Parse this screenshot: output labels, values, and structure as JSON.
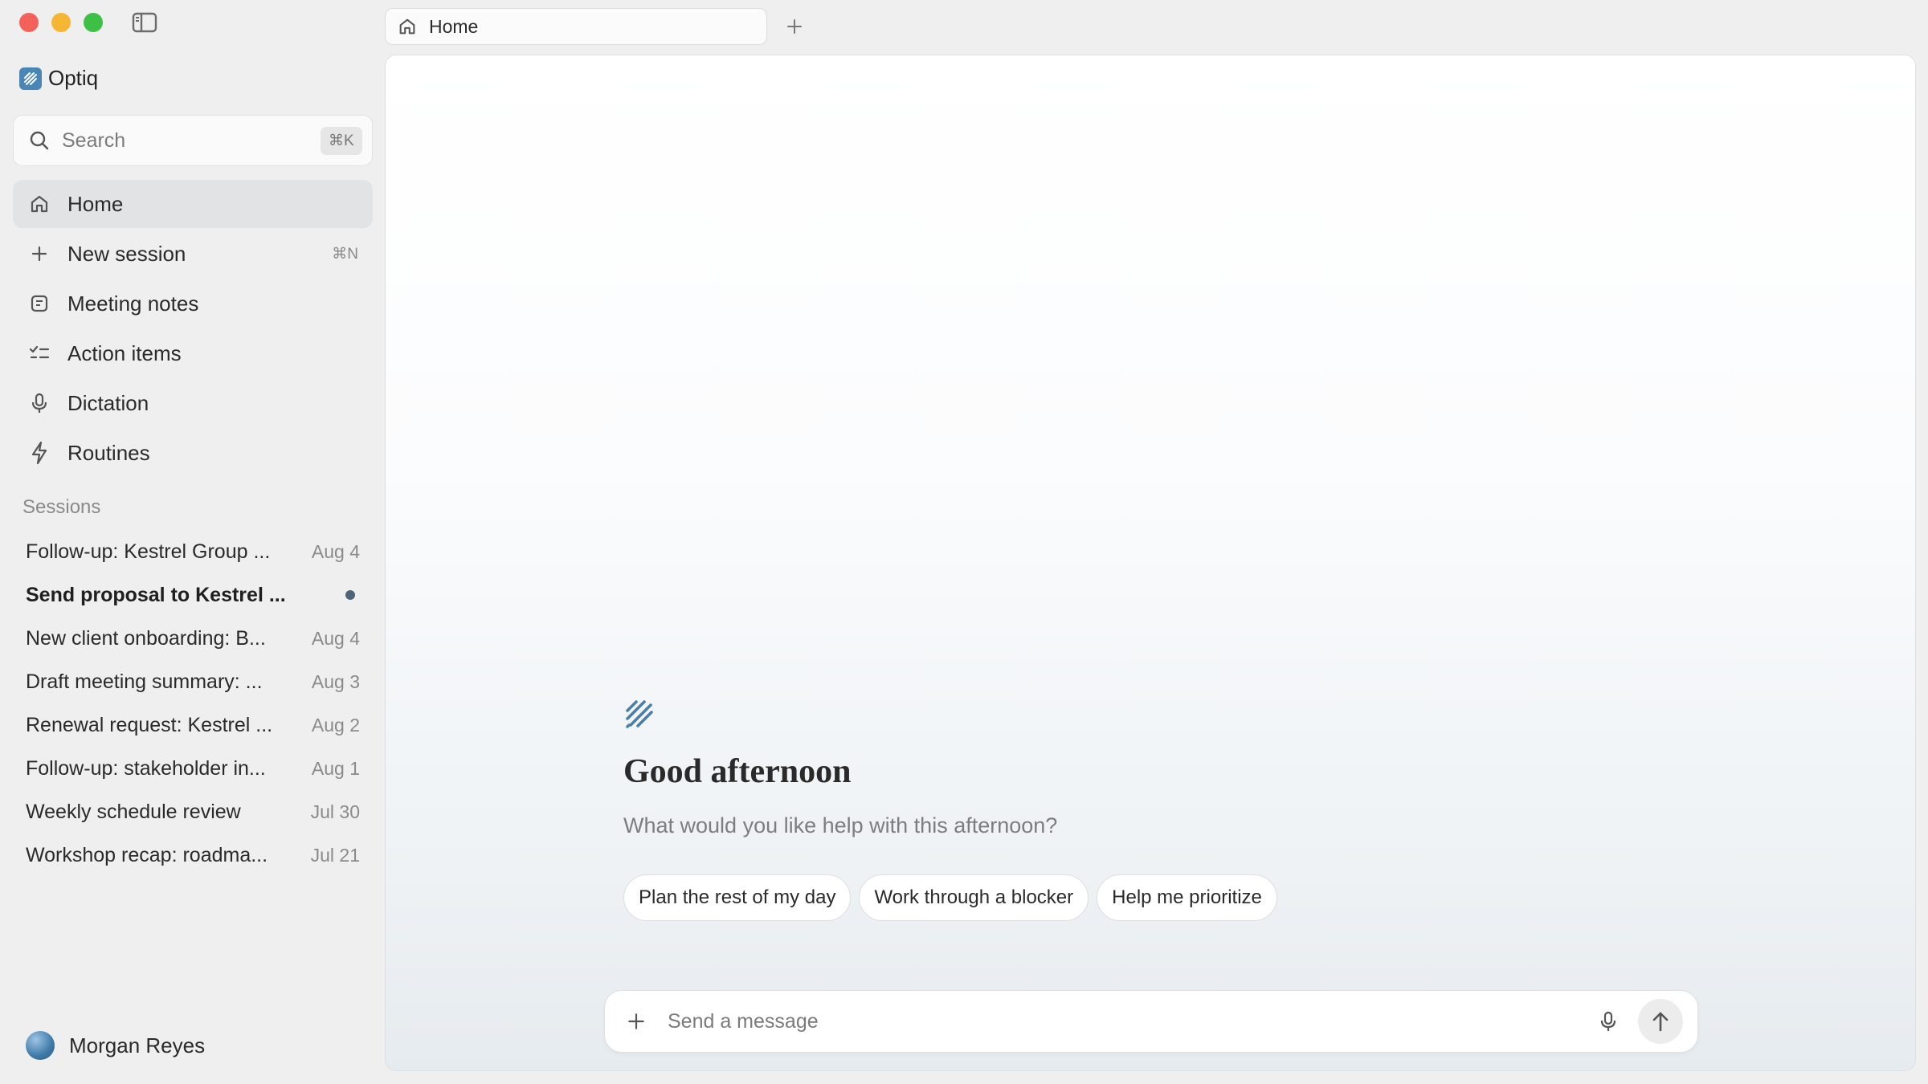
{
  "window": {
    "controls": [
      "close",
      "minimize",
      "maximize"
    ],
    "sidebar_toggle_icon": "sidebar-toggle-icon"
  },
  "brand": {
    "name": "Optiq",
    "logo_icon": "optiq-logo-icon",
    "accent": "#4a86b5"
  },
  "search": {
    "placeholder": "Search",
    "shortcut": "⌘K"
  },
  "nav": {
    "items": [
      {
        "label": "Home",
        "icon": "home-icon",
        "active": true
      },
      {
        "label": "New session",
        "icon": "plus-icon",
        "shortcut": "⌘N"
      },
      {
        "label": "Meeting notes",
        "icon": "notes-icon"
      },
      {
        "label": "Action items",
        "icon": "checklist-icon"
      },
      {
        "label": "Dictation",
        "icon": "mic-icon"
      },
      {
        "label": "Routines",
        "icon": "bolt-icon"
      }
    ]
  },
  "sessions": {
    "header": "Sessions",
    "items": [
      {
        "title": "Follow-up: Kestrel Group ...",
        "date": "Aug 4"
      },
      {
        "title": "Send proposal to Kestrel ...",
        "date": "",
        "unread": true
      },
      {
        "title": "New client onboarding: B...",
        "date": "Aug 4"
      },
      {
        "title": "Draft meeting summary: ...",
        "date": "Aug 3"
      },
      {
        "title": "Renewal request: Kestrel ...",
        "date": "Aug 2"
      },
      {
        "title": "Follow-up: stakeholder in...",
        "date": "Aug 1"
      },
      {
        "title": "Weekly schedule review",
        "date": "Jul 30"
      },
      {
        "title": "Workshop recap: roadma...",
        "date": "Jul 21"
      }
    ]
  },
  "user": {
    "name": "Morgan Reyes"
  },
  "tabs": [
    {
      "label": "Home",
      "icon": "home-icon"
    }
  ],
  "main": {
    "greeting": "Good afternoon",
    "subtitle": "What would you like help with this afternoon?",
    "suggestions": [
      "Plan the rest of my day",
      "Work through a blocker",
      "Help me prioritize"
    ],
    "composer": {
      "placeholder": "Send a message"
    }
  }
}
